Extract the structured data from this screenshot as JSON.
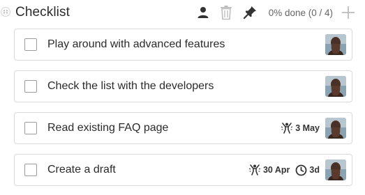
{
  "checklist": {
    "title": "Checklist",
    "progress_text": "0% done (0 / 4)"
  },
  "icons": {
    "drag": "drag-handle-icon",
    "person": "person-icon",
    "trash": "trash-icon",
    "pin": "pin-icon",
    "add": "plus-icon",
    "start_date": "person-excited-icon",
    "due": "clock-icon"
  },
  "items": [
    {
      "text": "Play around with advanced features",
      "checked": false
    },
    {
      "text": "Check the list with the developers",
      "checked": false
    },
    {
      "text": "Read existing FAQ page",
      "checked": false,
      "start_date": "3 May"
    },
    {
      "text": "Create a draft",
      "checked": false,
      "start_date": "30 Apr",
      "due": "3d"
    }
  ],
  "colors": {
    "border": "#d9d9d9",
    "text": "#2b2b2b",
    "muted": "#666666",
    "icon": "#333333"
  }
}
